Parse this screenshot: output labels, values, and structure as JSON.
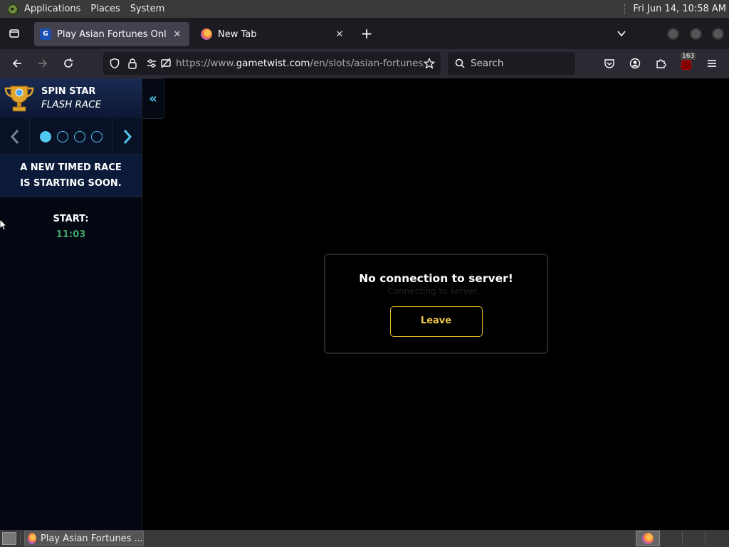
{
  "top_panel": {
    "menus": [
      "Applications",
      "Places",
      "System"
    ],
    "clock": "Fri Jun 14, 10:58 AM"
  },
  "tabs": [
    {
      "title": "Play Asian Fortunes Online f",
      "active": true
    },
    {
      "title": "New Tab",
      "active": false
    }
  ],
  "navbar": {
    "url_prefix": "https://www.",
    "url_domain": "gametwist.com",
    "url_path": "/en/slots/asian-fortunes/",
    "search_placeholder": "Search",
    "extension_badge": "163"
  },
  "sidebar": {
    "title_line1": "SPIN STAR",
    "title_line2": "FLASH RACE",
    "collapse_glyph": "«",
    "message": "A NEW TIMED RACE IS STARTING SOON.",
    "start_label": "START:",
    "start_time": "11:03",
    "pager_dots": 4,
    "active_dot": 0
  },
  "dialog": {
    "heading": "No connection to server!",
    "subtext": "Connecting to server...",
    "leave_label": "Leave"
  },
  "taskbar": {
    "window_title": "Play Asian Fortunes ..."
  },
  "colors": {
    "accent_cyan": "#50c8f0",
    "time_green": "#3fa66a",
    "leave_gold": "#e3b92e"
  }
}
